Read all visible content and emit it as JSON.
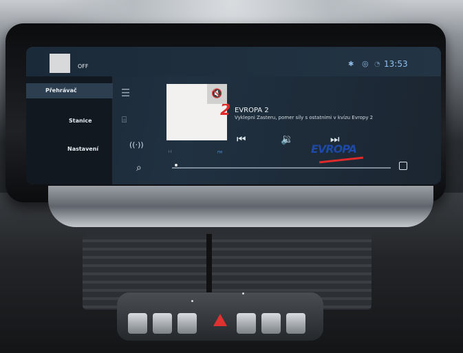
{
  "statusbar": {
    "power_label": "OFF",
    "clock": "13:53"
  },
  "sidebar": {
    "items": [
      {
        "label": "Přehrávač",
        "active": true
      },
      {
        "label": "Stanice",
        "active": false
      },
      {
        "label": "Nastavení",
        "active": false
      }
    ]
  },
  "now_playing": {
    "station": "EVROPA 2",
    "text": "Vyklepni Zasteru, pomer síly s ostatnimi v kvízu Evropy 2",
    "logo_main": "EVROPA",
    "logo_num": "2",
    "band": "FM",
    "mute_icon": "speaker-muted-icon",
    "icons": [
      "prev-track-icon",
      "volume-icon",
      "next-track-icon",
      "radio-signal-icon",
      "menu-icon",
      "search-icon",
      "bookmark-icon"
    ]
  }
}
